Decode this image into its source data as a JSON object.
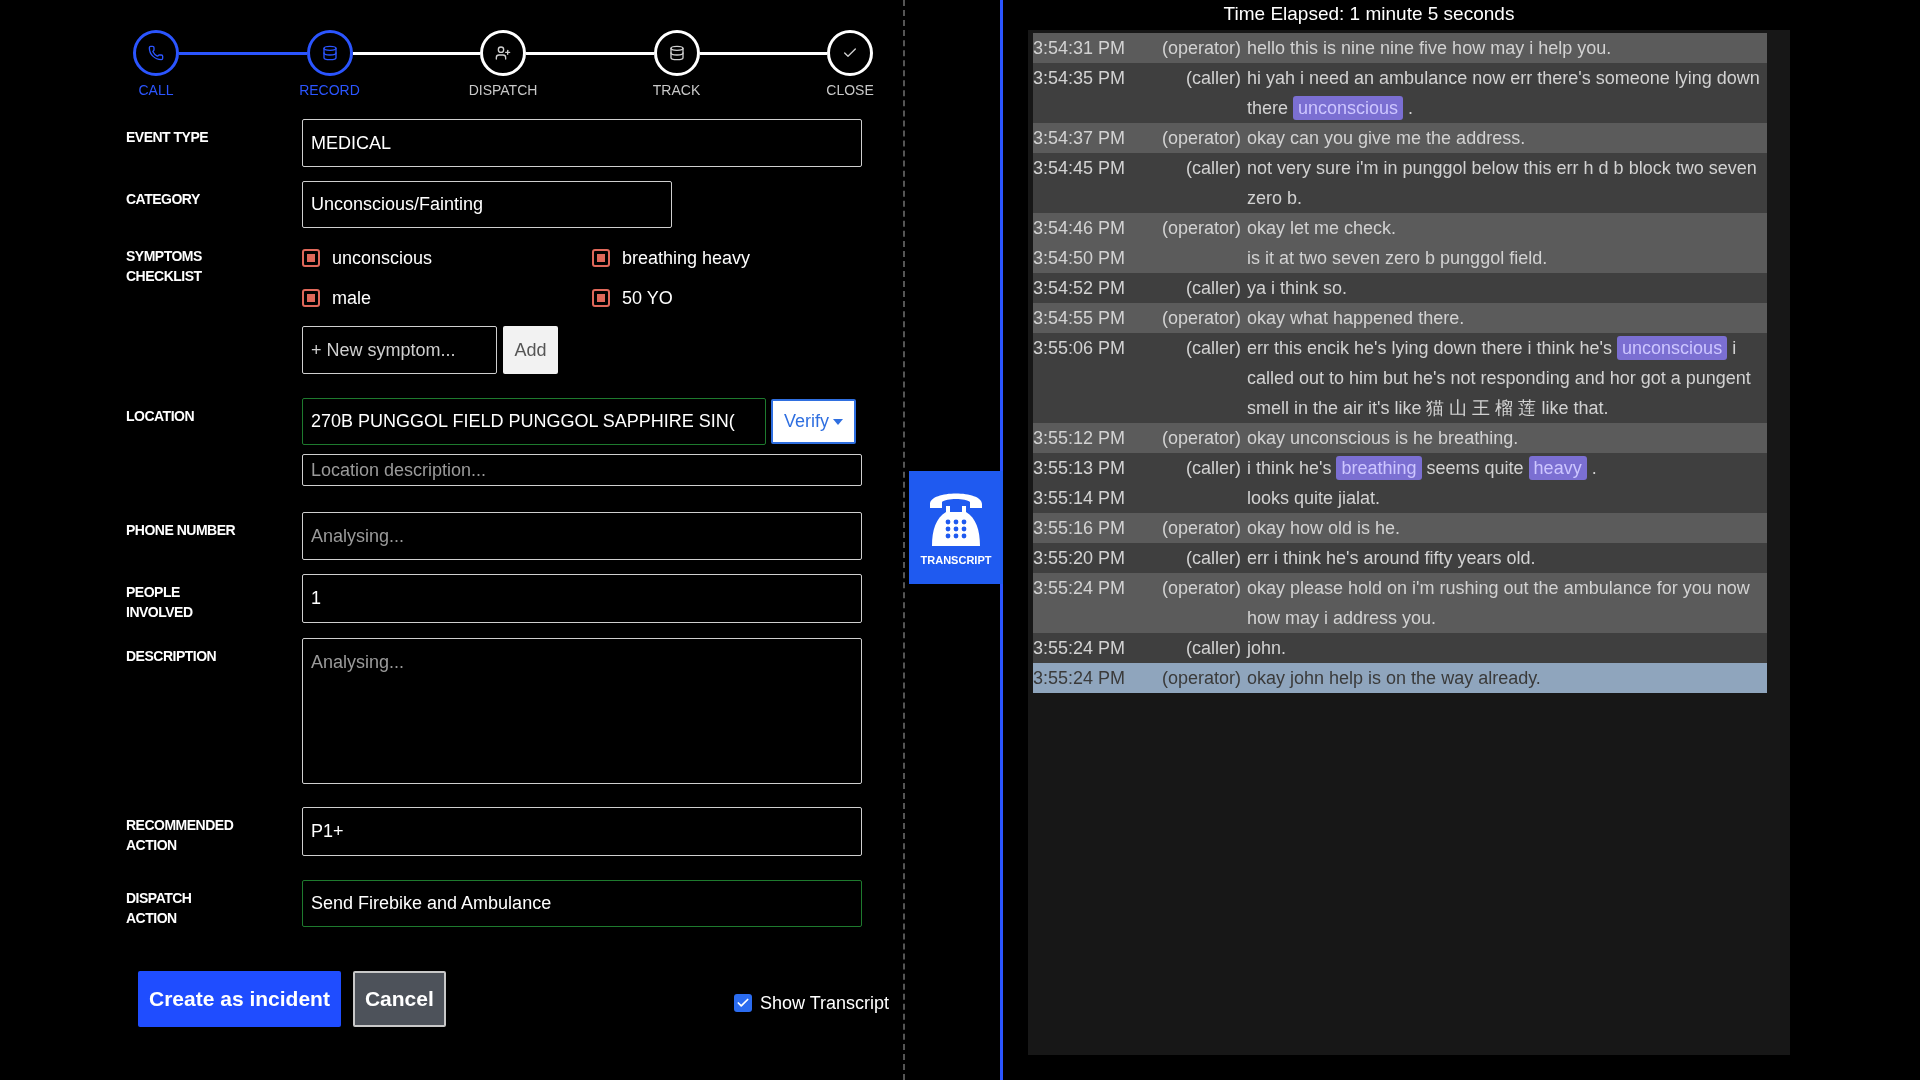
{
  "stepper": [
    {
      "label": "CALL",
      "active": true
    },
    {
      "label": "RECORD",
      "active": true
    },
    {
      "label": "DISPATCH",
      "active": false
    },
    {
      "label": "TRACK",
      "active": false
    },
    {
      "label": "CLOSE",
      "active": false
    }
  ],
  "form": {
    "event_type": {
      "label": "EVENT TYPE",
      "value": "MEDICAL"
    },
    "category": {
      "label": "CATEGORY",
      "value": "Unconscious/Fainting"
    },
    "symptoms": {
      "label": "SYMPTOMS CHECKLIST",
      "items": [
        {
          "text": "unconscious",
          "checked": true
        },
        {
          "text": "breathing heavy",
          "checked": true
        },
        {
          "text": "male",
          "checked": true
        },
        {
          "text": "50 YO",
          "checked": true
        }
      ],
      "new_placeholder": "+ New symptom...",
      "add_button": "Add"
    },
    "location": {
      "label": "LOCATION",
      "value": "270B PUNGGOL FIELD PUNGGOL SAPPHIRE SIN(",
      "validated": true,
      "verify_button": "Verify",
      "description_placeholder": "Location description..."
    },
    "phone_number": {
      "label": "PHONE NUMBER",
      "placeholder": "Analysing..."
    },
    "people_involved": {
      "label": "PEOPLE INVOLVED",
      "value": "1"
    },
    "description": {
      "label": "DESCRIPTION",
      "placeholder": "Analysing..."
    },
    "recommended_action": {
      "label": "RECOMMENDED ACTION",
      "value": "P1+"
    },
    "dispatch_action": {
      "label": "DISPATCH ACTION",
      "value": "Send Firebike and Ambulance",
      "validated": true
    }
  },
  "actions": {
    "create_button": "Create as incident",
    "cancel_button": "Cancel",
    "show_transcript": {
      "label": "Show Transcript",
      "checked": true
    }
  },
  "transcript_tab": {
    "label": "TRANSCRIPT"
  },
  "transcript": {
    "title": "Time Elapsed: 1 minute 5 seconds",
    "blocks": [
      {
        "kind": "operator",
        "speaker": "(operator)",
        "selected": false,
        "lines": [
          {
            "time": "3:54:31 PM",
            "segments": [
              {
                "text": "hello this is nine nine five how may i help you.",
                "highlighted": false
              }
            ]
          }
        ]
      },
      {
        "kind": "caller",
        "speaker": "(caller)",
        "selected": false,
        "lines": [
          {
            "time": "3:54:35 PM",
            "segments": [
              {
                "text": "hi yah i need an ambulance now err there's someone lying down there",
                "highlighted": false
              },
              {
                "text": "unconscious",
                "highlighted": true
              },
              {
                "text": ".",
                "highlighted": false
              }
            ]
          }
        ]
      },
      {
        "kind": "operator",
        "speaker": "(operator)",
        "selected": false,
        "lines": [
          {
            "time": "3:54:37 PM",
            "segments": [
              {
                "text": "okay can you give me the address.",
                "highlighted": false
              }
            ]
          }
        ]
      },
      {
        "kind": "caller",
        "speaker": "(caller)",
        "selected": false,
        "lines": [
          {
            "time": "3:54:45 PM",
            "segments": [
              {
                "text": "not very sure i'm in punggol below this err h d b block two seven zero b.",
                "highlighted": false
              }
            ]
          }
        ]
      },
      {
        "kind": "operator",
        "speaker": "(operator)",
        "selected": false,
        "lines": [
          {
            "time": "3:54:46 PM",
            "segments": [
              {
                "text": "okay let me check.",
                "highlighted": false
              }
            ]
          },
          {
            "time": "3:54:50 PM",
            "segments": [
              {
                "text": "is it at two seven zero b punggol field.",
                "highlighted": false
              }
            ]
          }
        ]
      },
      {
        "kind": "caller",
        "speaker": "(caller)",
        "selected": false,
        "lines": [
          {
            "time": "3:54:52 PM",
            "segments": [
              {
                "text": "ya i think so.",
                "highlighted": false
              }
            ]
          }
        ]
      },
      {
        "kind": "operator",
        "speaker": "(operator)",
        "selected": false,
        "lines": [
          {
            "time": "3:54:55 PM",
            "segments": [
              {
                "text": "okay what happened there.",
                "highlighted": false
              }
            ]
          }
        ]
      },
      {
        "kind": "caller",
        "speaker": "(caller)",
        "selected": false,
        "lines": [
          {
            "time": "3:55:06 PM",
            "segments": [
              {
                "text": "err this encik he's lying down there i think he's",
                "highlighted": false
              },
              {
                "text": "unconscious",
                "highlighted": true
              },
              {
                "text": "i called out to him but he's not responding and hor got a pungent smell in the air it's like 猫 山 王 榴 莲 like that.",
                "highlighted": false
              }
            ]
          }
        ]
      },
      {
        "kind": "operator",
        "speaker": "(operator)",
        "selected": false,
        "lines": [
          {
            "time": "3:55:12 PM",
            "segments": [
              {
                "text": "okay unconscious is he breathing.",
                "highlighted": false
              }
            ]
          }
        ]
      },
      {
        "kind": "caller",
        "speaker": "(caller)",
        "selected": false,
        "lines": [
          {
            "time": "3:55:13 PM",
            "segments": [
              {
                "text": "i think he's",
                "highlighted": false
              },
              {
                "text": "breathing",
                "highlighted": true
              },
              {
                "text": "seems quite",
                "highlighted": false
              },
              {
                "text": "heavy",
                "highlighted": true
              },
              {
                "text": ".",
                "highlighted": false
              }
            ]
          },
          {
            "time": "3:55:14 PM",
            "segments": [
              {
                "text": "looks quite jialat.",
                "highlighted": false
              }
            ]
          }
        ]
      },
      {
        "kind": "operator",
        "speaker": "(operator)",
        "selected": false,
        "lines": [
          {
            "time": "3:55:16 PM",
            "segments": [
              {
                "text": "okay how old is he.",
                "highlighted": false
              }
            ]
          }
        ]
      },
      {
        "kind": "caller",
        "speaker": "(caller)",
        "selected": false,
        "lines": [
          {
            "time": "3:55:20 PM",
            "segments": [
              {
                "text": "err i think he's around fifty years old.",
                "highlighted": false
              }
            ]
          }
        ]
      },
      {
        "kind": "operator",
        "speaker": "(operator)",
        "selected": false,
        "lines": [
          {
            "time": "3:55:24 PM",
            "segments": [
              {
                "text": "okay please hold on i'm rushing out the ambulance for you now how may i address you.",
                "highlighted": false
              }
            ]
          }
        ]
      },
      {
        "kind": "caller",
        "speaker": "(caller)",
        "selected": false,
        "lines": [
          {
            "time": "3:55:24 PM",
            "segments": [
              {
                "text": "john.",
                "highlighted": false
              }
            ]
          }
        ]
      },
      {
        "kind": "operator",
        "speaker": "(operator)",
        "selected": true,
        "lines": [
          {
            "time": "3:55:24 PM",
            "segments": [
              {
                "text": "okay john help is on the way already.",
                "highlighted": false
              }
            ]
          }
        ]
      }
    ]
  }
}
